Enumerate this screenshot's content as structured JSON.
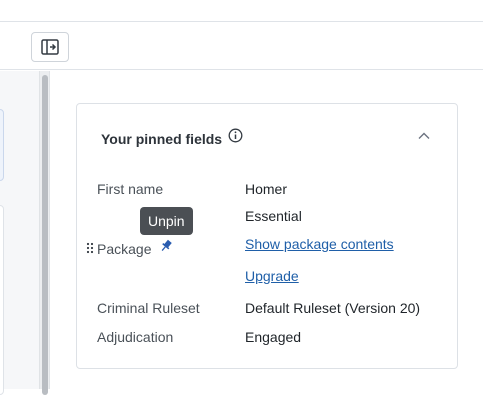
{
  "toolbar": {
    "collapse_icon": "sidebar-collapse-icon"
  },
  "card": {
    "title": "Your pinned fields",
    "tooltip": "Unpin",
    "rows": {
      "first_name": {
        "label": "First name",
        "value": "Homer"
      },
      "package": {
        "label": "Package",
        "value": "Essential",
        "show_contents": "Show package contents",
        "upgrade": "Upgrade"
      },
      "criminal_ruleset": {
        "label": "Criminal Ruleset",
        "value": "Default Ruleset (Version 20)"
      },
      "adjudication": {
        "label": "Adjudication",
        "value": "Engaged"
      }
    }
  },
  "colors": {
    "link": "#1f5fa8",
    "tooltip_bg": "#4b4f54",
    "pin": "#2a5db0"
  }
}
